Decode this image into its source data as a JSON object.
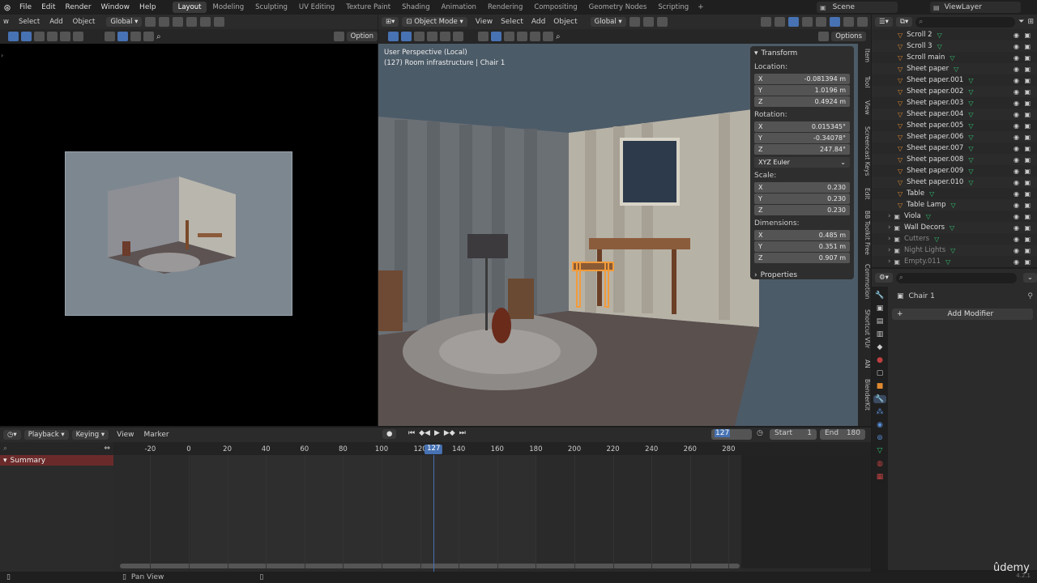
{
  "menu": [
    "File",
    "Edit",
    "Render",
    "Window",
    "Help"
  ],
  "workspaces": [
    "Layout",
    "Modeling",
    "Sculpting",
    "UV Editing",
    "Texture Paint",
    "Shading",
    "Animation",
    "Rendering",
    "Compositing",
    "Geometry Nodes",
    "Scripting"
  ],
  "scene": "Scene",
  "view_layer": "ViewLayer",
  "left_header": {
    "menus": [
      "w",
      "Select",
      "Add",
      "Object"
    ],
    "orientation": "Global",
    "options": "Option"
  },
  "viewport": {
    "mode": "Object Mode",
    "menus": [
      "View",
      "Select",
      "Add",
      "Object"
    ],
    "orientation": "Global",
    "options": "Options",
    "overlay_line1": "User Perspective (Local)",
    "overlay_line2": "(127) Room infrastructure | Chair 1"
  },
  "npanel": {
    "title": "Transform",
    "location_label": "Location:",
    "location": {
      "x": "-0.081394 m",
      "y": "1.0196 m",
      "z": "0.4924 m"
    },
    "rotation_label": "Rotation:",
    "rotation": {
      "x": "0.015345°",
      "y": "-0.34078°",
      "z": "247.84°"
    },
    "rotation_mode": "XYZ Euler",
    "scale_label": "Scale:",
    "scale": {
      "x": "0.230",
      "y": "0.230",
      "z": "0.230"
    },
    "dimensions_label": "Dimensions:",
    "dimensions": {
      "x": "0.485 m",
      "y": "0.351 m",
      "z": "0.907 m"
    },
    "properties": "Properties",
    "tabs": [
      "Item",
      "Tool",
      "View",
      "Screencast Keys",
      "Edit",
      "BB Toolkit Free",
      "Commotion",
      "Shortcut VUr",
      "AN",
      "BlenderKit"
    ]
  },
  "outliner": {
    "items": [
      {
        "name": "Scroll 2",
        "indent": 2
      },
      {
        "name": "Scroll 3",
        "indent": 2
      },
      {
        "name": "Scroll main",
        "indent": 2
      },
      {
        "name": "Sheet paper",
        "indent": 2
      },
      {
        "name": "Sheet paper.001",
        "indent": 2
      },
      {
        "name": "Sheet paper.002",
        "indent": 2
      },
      {
        "name": "Sheet paper.003",
        "indent": 2
      },
      {
        "name": "Sheet paper.004",
        "indent": 2
      },
      {
        "name": "Sheet paper.005",
        "indent": 2
      },
      {
        "name": "Sheet paper.006",
        "indent": 2
      },
      {
        "name": "Sheet paper.007",
        "indent": 2
      },
      {
        "name": "Sheet paper.008",
        "indent": 2
      },
      {
        "name": "Sheet paper.009",
        "indent": 2
      },
      {
        "name": "Sheet paper.010",
        "indent": 2
      },
      {
        "name": "Table",
        "indent": 2
      },
      {
        "name": "Table Lamp",
        "indent": 2
      },
      {
        "name": "Viola",
        "indent": 1
      },
      {
        "name": "Wall Decors",
        "indent": 1
      },
      {
        "name": "Cutters",
        "indent": 1
      },
      {
        "name": "Night Lights",
        "indent": 1
      },
      {
        "name": "Empty.011",
        "indent": 1
      }
    ]
  },
  "properties": {
    "object_name": "Chair 1",
    "add_modifier": "Add Modifier"
  },
  "timeline": {
    "menus": [
      "Playback",
      "Keying",
      "View",
      "Marker"
    ],
    "current_frame": "127",
    "start_label": "Start",
    "start": "1",
    "end_label": "End",
    "end": "180",
    "summary": "Summary",
    "ticks": [
      "-20",
      "0",
      "20",
      "40",
      "60",
      "80",
      "100",
      "120",
      "140",
      "160",
      "180",
      "200",
      "220",
      "240",
      "260",
      "280"
    ]
  },
  "status": {
    "pan_view": "Pan View",
    "version": "4.2.1"
  },
  "watermark": "ûdemy",
  "colors": {
    "accent": "#4772b3",
    "selection": "#f29b3a",
    "summary": "#6b2a2a"
  }
}
